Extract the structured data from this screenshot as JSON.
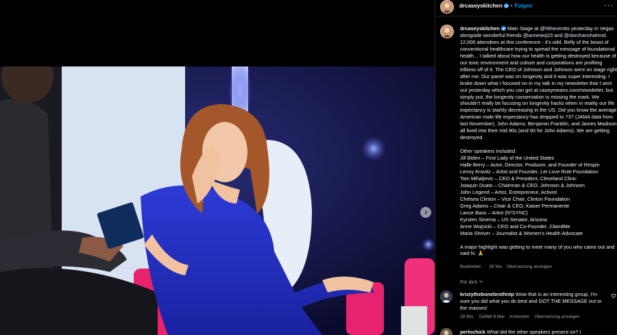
{
  "post": {
    "username": "drcaseyskitchen",
    "follow_label": "Folgen",
    "more_label": "···",
    "caption_user": "drcaseyskitchen",
    "caption_1": " Main Stage at ",
    "mention_1": "@hltheventts",
    "caption_2": " yesterday in Vegas alongside wonderful friends ",
    "mention_2": "@annewoj23",
    "caption_3": " and ",
    "mention_3": "@darshanshahmd",
    "caption_4": ". 12,000 attendees at this conference - it's wild. Belly of the beast of conventional healthcare trying to spread the message of foundational health... I talked about how our health is getting destroyed because of our toxic environment and culture and corporations are profiting trillions off of it. The CEO of Johnson and Johnson went on stage right after me. Our panel was on longevity and it was super interesting. I broke down what I focused on in my talk in my newsletter that I sent out yesterday which you can get at caseymeans.com/newsletter, but simply put, the longevity conservation is missing the mark. We shouldn't really be focusing on longevity hacks when in reality our life expectancy is starkly decreasing in the US. Did you know the average American male life expectancy has dropped to 73? (JAMA data from last November). John Adams, Benjamin Franklin, and James Madison all lived into their mid 80s (and 90 for John Adams). We are getting destroyed.\n\nOther speakers included:\nJill Biden – First Lady of the United States\nHalle Berry – Actor, Director, Producer, and Founder of Respin\nLenny Kravitz – Artist and Founder, Let Love Rule Foundation\nTom Mihaljevic – CEO & President, Cleveland Clinic\nJoaquin Duato – Chairman & CEO, Johnson & Johnson\nJohn Legend – Artist, Entrepreneur, Activist\nChelsea Clinton – Vice Chair, Clinton Foundation\nGreg Adams – Chair & CEO, Kaiser Permanente\nLance Bass – Artist (N*SYNC)\nKyrsten Sinema – US Senator, Arizona\nAnne Wojcicki – CEO and Co-Founder, 23andMe\nMaria Shriver – Journalist & Women's Health Advocate\n\nA major highlight was getting to meet many of you who came out and said hi. 🙏",
    "edited_label": "Bearbeitet",
    "edited_age": "28 Wo.",
    "translate_label": "Übersetzung anzeigen",
    "for_you_label": "Für dich"
  },
  "comments": [
    {
      "username": "kristythebonebrothntp",
      "text": " Wow that is an interesting group, I'm sure you did what you do best and GOT THE MESSAGE out to the masses!",
      "age": "28 Wo.",
      "likes": "Gefällt 8 Mal",
      "reply_label": "Antworten",
      "translate_label": "Übersetzung anzeigen"
    },
    {
      "username": "perlochick",
      "text": " What did the other speakers present on? I"
    }
  ],
  "colors": {
    "background": "#000000",
    "text": "#f5f5f5",
    "muted": "#a8a8a8",
    "link": "#0095f6",
    "mention": "#e0f1ff",
    "verified": "#3897f0"
  },
  "icons": {
    "verified": "verified-badge-icon",
    "next": "chevron-right-icon",
    "more": "more-options-icon",
    "like": "heart-icon",
    "collapse": "chevron-down-icon"
  }
}
